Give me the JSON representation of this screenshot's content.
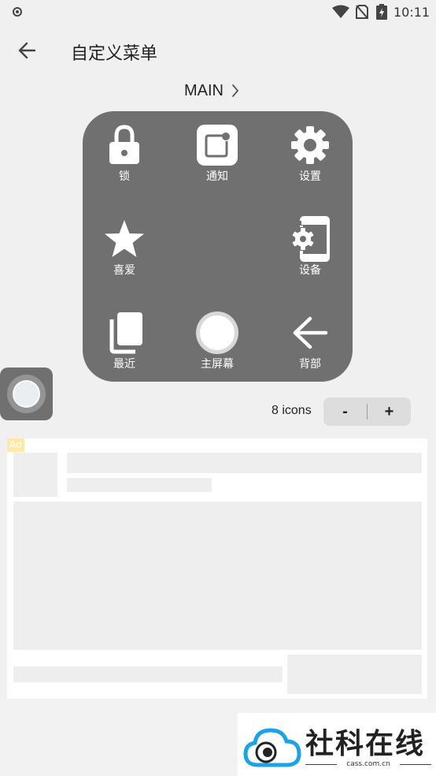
{
  "status_bar": {
    "time": "10:11"
  },
  "app_bar": {
    "title": "自定义菜单"
  },
  "menu_selector": {
    "label": "MAIN"
  },
  "menu_items": [
    {
      "label": "锁",
      "icon": "lock-icon"
    },
    {
      "label": "通知",
      "icon": "notification-icon"
    },
    {
      "label": "设置",
      "icon": "gear-icon"
    },
    {
      "label": "喜爱",
      "icon": "star-icon"
    },
    {
      "label": "设备",
      "icon": "device-settings-icon"
    },
    {
      "label": "最近",
      "icon": "recent-apps-icon"
    },
    {
      "label": "主屏幕",
      "icon": "home-circle-icon"
    },
    {
      "label": "背部",
      "icon": "back-arrow-icon"
    }
  ],
  "icon_count": {
    "text": "8 icons",
    "minus_label": "-",
    "plus_label": "+"
  },
  "ad": {
    "badge": "Ad"
  },
  "watermark": {
    "title": "社科在线",
    "subtitle": "cass.com.cn"
  },
  "colors": {
    "panel": "#707070",
    "background": "#f0f0f0",
    "stepper": "#dddddd",
    "ad_badge": "#ffe9a8",
    "watermark_blue": "#1aa3e8"
  }
}
